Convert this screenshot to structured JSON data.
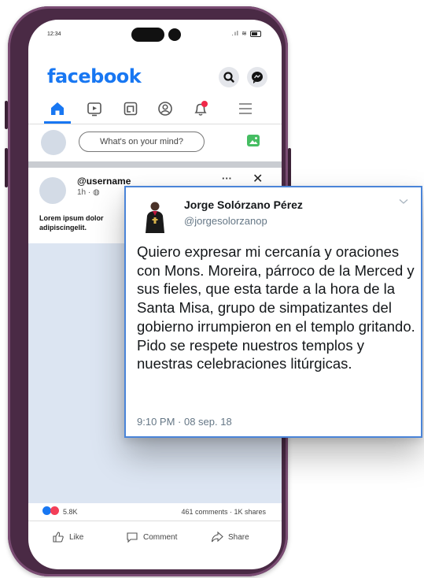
{
  "status_bar": {
    "time": "12:34"
  },
  "facebook": {
    "logo": "facebook",
    "header_icons": [
      "search-icon",
      "messenger-icon"
    ],
    "nav_icons": [
      "home-icon",
      "video-icon",
      "marketplace-icon",
      "profile-icon",
      "notifications-icon",
      "menu-icon"
    ],
    "composer": {
      "placeholder": "What's on your mind?"
    },
    "post": {
      "username": "@username",
      "time": "1h",
      "text": "Lorem ipsum dolor adipiscingelit.",
      "reactions_count": "5.8K",
      "comments_shares": "461 comments · 1K shares",
      "actions": {
        "like": "Like",
        "comment": "Comment",
        "share": "Share"
      }
    }
  },
  "tweet": {
    "name": "Jorge Solórzano Pérez",
    "handle": "@jorgesolorzanop",
    "body": "Quiero expresar mi cercanía y oraciones con Mons. Moreira, párroco de la Merced y sus fieles, que esta tarde a la hora de la Santa Misa, grupo de simpatizantes del gobierno irrumpieron en el templo gritando. Pido se respete nuestros templos y nuestras celebraciones litúrgicas.",
    "timestamp": "9:10 PM · 08 sep. 18"
  },
  "colors": {
    "facebook_blue": "#1877f2",
    "phone_frame": "#4a2a45",
    "tweet_border": "#4a84d8",
    "like_blue": "#1877f2",
    "love_red": "#f33e58",
    "notification_badge": "#f02849"
  }
}
